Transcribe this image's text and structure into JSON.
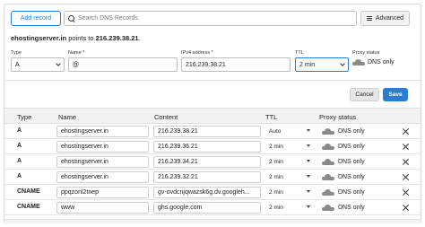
{
  "toolbar": {
    "add_label": "Add record",
    "search_placeholder": "Search DNS Records",
    "advanced_label": "Advanced"
  },
  "points_to": {
    "domain": "ehostingserver.in",
    "middle": " points to ",
    "ip": "216.239.38.21",
    "suffix": "."
  },
  "form": {
    "type_label": "Type",
    "type_value": "A",
    "name_label": "Name *",
    "name_value": "@",
    "ipv4_label": "IPv4 address *",
    "ipv4_value": "216.239.38.21",
    "ttl_label": "TTL",
    "ttl_value": "2 min",
    "proxy_label": "Proxy status",
    "proxy_value": "DNS only",
    "cancel_label": "Cancel",
    "save_label": "Save"
  },
  "table": {
    "headers": [
      "Type",
      "Name",
      "Content",
      "TTL",
      "Proxy status"
    ],
    "rows": [
      {
        "type": "A",
        "name": "ehostingserver.in",
        "content": "216.239.38.21",
        "ttl": "Auto",
        "proxy": "DNS only"
      },
      {
        "type": "A",
        "name": "ehostingserver.in",
        "content": "216.239.36.21",
        "ttl": "2 min",
        "proxy": "DNS only"
      },
      {
        "type": "A",
        "name": "ehostingserver.in",
        "content": "216.239.34.21",
        "ttl": "2 min",
        "proxy": "DNS only"
      },
      {
        "type": "A",
        "name": "ehostingserver.in",
        "content": "216.239.32.21",
        "ttl": "2 min",
        "proxy": "DNS only"
      },
      {
        "type": "CNAME",
        "name": "ppqzonl2tnep",
        "content": "gv-ovdcnjqwazsk6g.dv.googleh...",
        "ttl": "2 min",
        "proxy": "DNS only"
      },
      {
        "type": "CNAME",
        "name": "www",
        "content": "ghs.google.com",
        "ttl": "2 min",
        "proxy": "DNS only"
      }
    ]
  },
  "colors": {
    "accent": "#2c7cd1",
    "cloud": "#8a8a8a"
  },
  "icons": [
    "search-icon",
    "advanced-filter-icon",
    "chevron-down-icon",
    "cloud-icon",
    "close-icon"
  ]
}
